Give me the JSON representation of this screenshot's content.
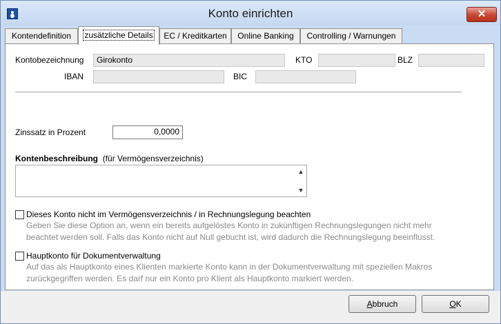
{
  "window": {
    "title": "Konto einrichten",
    "close_symbol": "✕"
  },
  "tabs": [
    {
      "label": "Kontendefinition"
    },
    {
      "label": "zusätzliche Details",
      "active": true
    },
    {
      "label": "EC / Kreditkarten"
    },
    {
      "label": "Online Banking"
    },
    {
      "label": "Controlling / Warnungen"
    }
  ],
  "form": {
    "kontobezeichnung_label": "Kontobezeichnung",
    "kontobezeichnung_value": "Girokonto",
    "kto_label": "KTO",
    "kto_value": "",
    "blz_label": "BLZ",
    "blz_value": "",
    "iban_label": "IBAN",
    "iban_value": "",
    "bic_label": "BIC",
    "bic_value": "",
    "zinssatz_label": "Zinssatz in Prozent",
    "zinssatz_value": "0,0000",
    "beschreibung_label": "Kontenbeschreibung",
    "beschreibung_hint": "(für Vermögensverzeichnis)",
    "beschreibung_value": ""
  },
  "options": [
    {
      "label": "Dieses Konto nicht im Vermögensverzeichnis / in Rechnungslegung beachten",
      "checked": false,
      "note_line1": "Geben Sie diese Option an, wenn ein bereits aufgelöstes Konto in zukünftigen Rechnungslegungen nicht mehr",
      "note_line2": "beachtet werden soll. Falls das Konto nicht auf Null gebucht ist, wird dadurch die Rechnungslegung beeinflusst."
    },
    {
      "label": "Hauptkonto für Dokumentverwaltung",
      "checked": false,
      "note_line1": "Auf das als Hauptkonto eines Klienten markierte Konto kann in der Dokumentverwaltung mit speziellen Makros",
      "note_line2": "zurückgegriffen werden. Es darf nur ein Konto pro Klient als Hauptkonto markiert werden."
    }
  ],
  "buttons": {
    "cancel_first": "A",
    "cancel_rest": "bbruch",
    "ok_first": "O",
    "ok_rest": "K"
  },
  "colors": {
    "title_bar": "#c9dcf3",
    "close_button": "#c9452f",
    "panel": "#ffffff",
    "disabled_field": "#e9e9e9",
    "note_text": "#8a8a8a"
  }
}
